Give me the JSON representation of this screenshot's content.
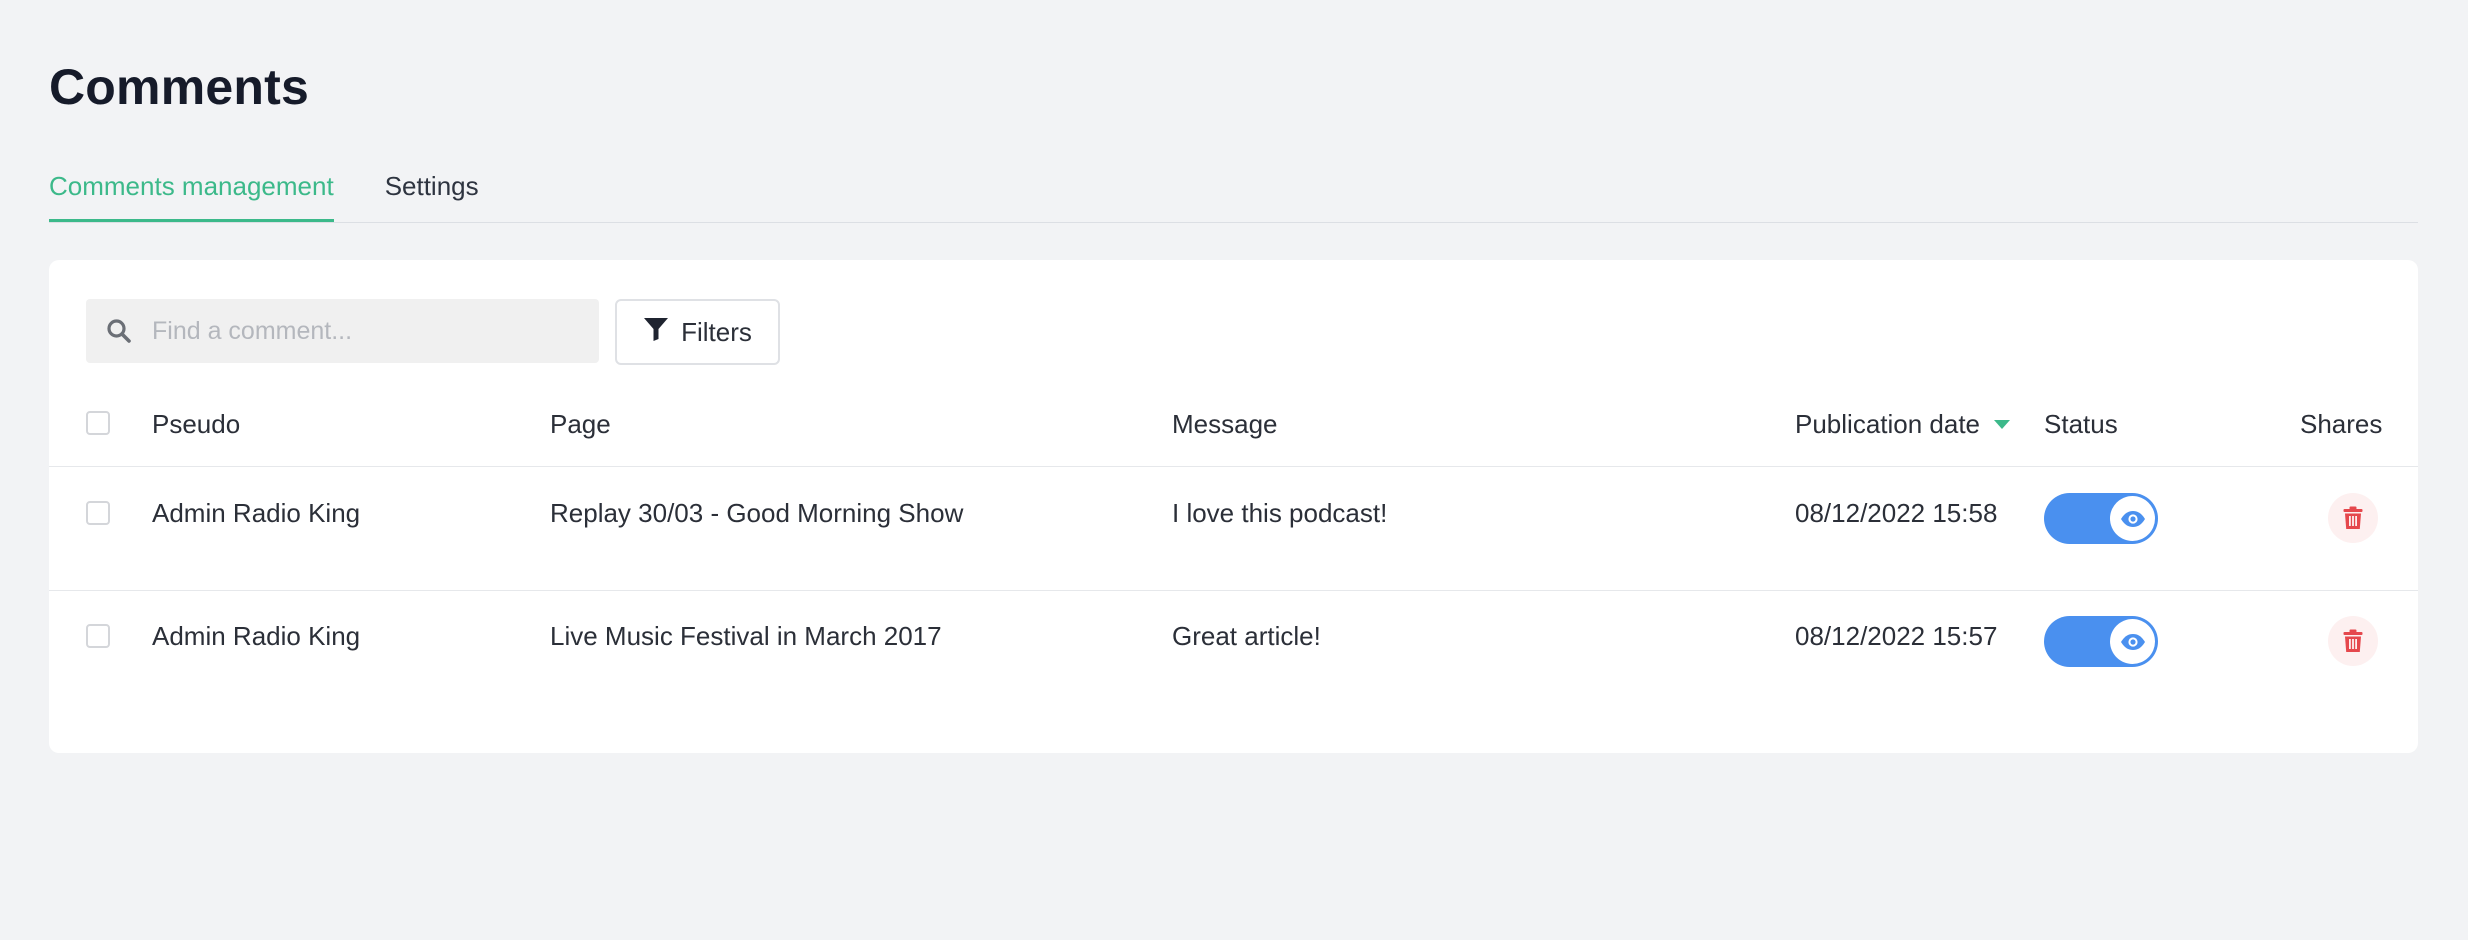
{
  "page": {
    "title": "Comments"
  },
  "tabs": [
    {
      "label": "Comments management",
      "active": true
    },
    {
      "label": "Settings",
      "active": false
    }
  ],
  "toolbar": {
    "search_placeholder": "Find a comment...",
    "search_value": "",
    "filters_label": "Filters"
  },
  "table": {
    "columns": {
      "pseudo": "Pseudo",
      "page": "Page",
      "message": "Message",
      "publication_date": "Publication date",
      "status": "Status",
      "shares": "Shares"
    },
    "sort": {
      "column": "publication_date",
      "direction": "descending"
    },
    "rows": [
      {
        "pseudo": "Admin Radio King",
        "page": "Replay 30/03 - Good Morning Show",
        "message": "I love this podcast!",
        "publication_date": "08/12/2022 15:58",
        "status": "visible",
        "status_icon": "eye-icon",
        "checked": false
      },
      {
        "pseudo": "Admin Radio King",
        "page": "Live Music Festival in March 2017",
        "message": "Great article!",
        "publication_date": "08/12/2022 15:57",
        "status": "visible",
        "status_icon": "eye-icon",
        "checked": false
      }
    ]
  },
  "colors": {
    "accent": "#3cb98a",
    "toggle_on": "#4a90ef",
    "delete": "#e5484d",
    "background": "#f2f3f5"
  }
}
